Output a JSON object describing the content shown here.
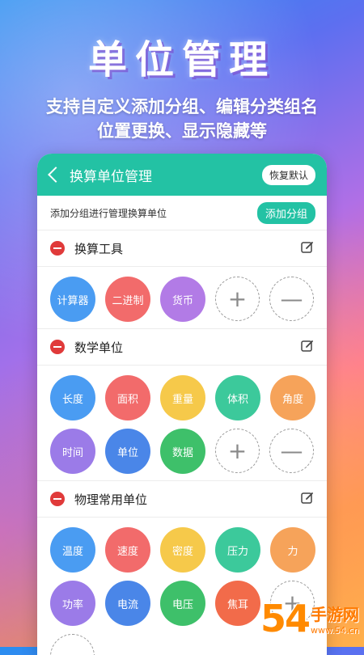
{
  "promo": {
    "headline": "单位管理",
    "line1": "支持自定义添加分组、编辑分类组名",
    "line2": "位置更换、显示隐藏等"
  },
  "header": {
    "title": "换算单位管理",
    "reset_label": "恢复默认"
  },
  "add_row": {
    "hint": "添加分组进行管理换算单位",
    "button_label": "添加分组"
  },
  "controls": {
    "add_symbol": "+",
    "remove_symbol": "—"
  },
  "groups": [
    {
      "name": "换算工具",
      "items": [
        {
          "label": "计算器",
          "color": "#4a9cf2"
        },
        {
          "label": "二进制",
          "color": "#f26b6b"
        },
        {
          "label": "货币",
          "color": "#b27be6"
        }
      ]
    },
    {
      "name": "数学单位",
      "items": [
        {
          "label": "长度",
          "color": "#4a9cf2"
        },
        {
          "label": "面积",
          "color": "#f26b6b"
        },
        {
          "label": "重量",
          "color": "#f6c94a"
        },
        {
          "label": "体积",
          "color": "#3cc99b"
        },
        {
          "label": "角度",
          "color": "#f6a35a"
        },
        {
          "label": "时间",
          "color": "#9b7be8"
        },
        {
          "label": "单位",
          "color": "#4a86e8"
        },
        {
          "label": "数据",
          "color": "#3ec06a"
        }
      ]
    },
    {
      "name": "物理常用单位",
      "items": [
        {
          "label": "温度",
          "color": "#4a9cf2"
        },
        {
          "label": "速度",
          "color": "#f26b6b"
        },
        {
          "label": "密度",
          "color": "#f6c94a"
        },
        {
          "label": "压力",
          "color": "#3cc99b"
        },
        {
          "label": "力",
          "color": "#f6a35a"
        },
        {
          "label": "功率",
          "color": "#9b7be8"
        },
        {
          "label": "电流",
          "color": "#4a86e8"
        },
        {
          "label": "电压",
          "color": "#3ec06a"
        },
        {
          "label": "焦耳",
          "color": "#f26b4a"
        }
      ]
    }
  ],
  "watermark": {
    "logo": "54",
    "brand": "手游网",
    "url": "www.54.cn"
  }
}
